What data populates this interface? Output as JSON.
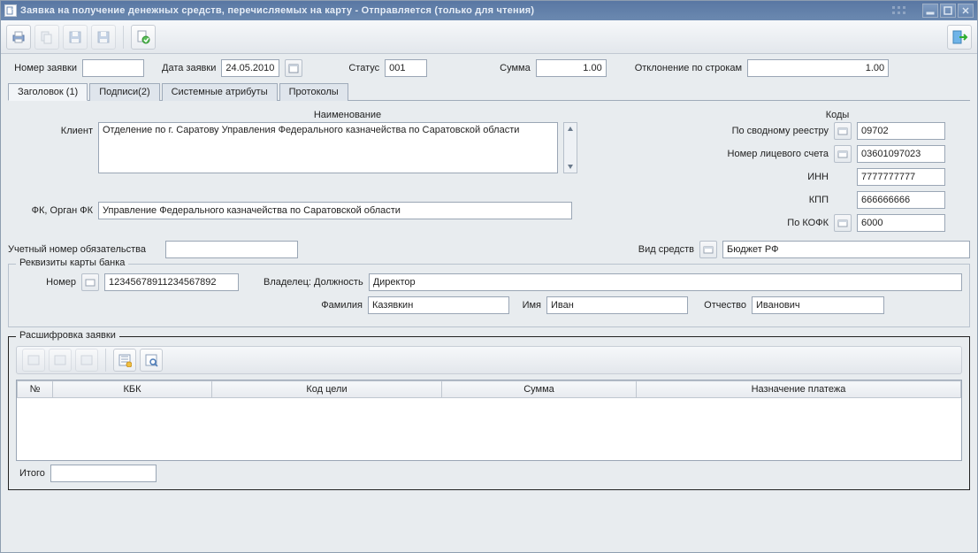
{
  "window": {
    "title": "Заявка на получение денежных средств, перечисляемых на карту - Отправляется (только для чтения)"
  },
  "toolbar": {
    "icons": [
      "print",
      "copy",
      "save",
      "save2",
      "approve",
      "exit"
    ]
  },
  "header": {
    "number_label": "Номер заявки",
    "number_value": "",
    "date_label": "Дата заявки",
    "date_value": "24.05.2010",
    "status_label": "Статус",
    "status_value": "001",
    "sum_label": "Сумма",
    "sum_value": "1.00",
    "deviation_label": "Отклонение по строкам",
    "deviation_value": "1.00"
  },
  "tabs": [
    "Заголовок (1)",
    "Подписи(2)",
    "Системные атрибуты",
    "Протоколы"
  ],
  "form": {
    "name_header": "Наименование",
    "codes_header": "Коды",
    "client_label": "Клиент",
    "client_value": "Отделение по г. Саратову Управления Федерального казначейства по Саратовской области",
    "svod_label": "По сводному реестру",
    "svod_value": "09702",
    "acct_label": "Номер лицевого счета",
    "acct_value": "03601097023",
    "inn_label": "ИНН",
    "inn_value": "7777777777",
    "kpp_label": "КПП",
    "kpp_value": "666666666",
    "fk_label": "ФК, Орган ФК",
    "fk_value": "Управление Федерального казначейства по Саратовской области",
    "kofk_label": "По КОФК",
    "kofk_value": "6000",
    "obligation_label": "Учетный номер обязательства",
    "obligation_value": "",
    "funds_label": "Вид средств",
    "funds_value": "Бюджет РФ"
  },
  "card": {
    "legend": "Реквизиты карты банка",
    "number_label": "Номер",
    "number_value": "12345678911234567892",
    "owner_label": "Владелец: Должность",
    "owner_value": "Директор",
    "lastname_label": "Фамилия",
    "lastname_value": "Казявкин",
    "firstname_label": "Имя",
    "firstname_value": "Иван",
    "patronymic_label": "Отчество",
    "patronymic_value": "Иванович"
  },
  "detail": {
    "legend": "Расшифровка заявки",
    "columns": [
      "№",
      "КБК",
      "Код цели",
      "Сумма",
      "Назначение платежа"
    ],
    "totals_label": "Итого",
    "totals_value": ""
  }
}
